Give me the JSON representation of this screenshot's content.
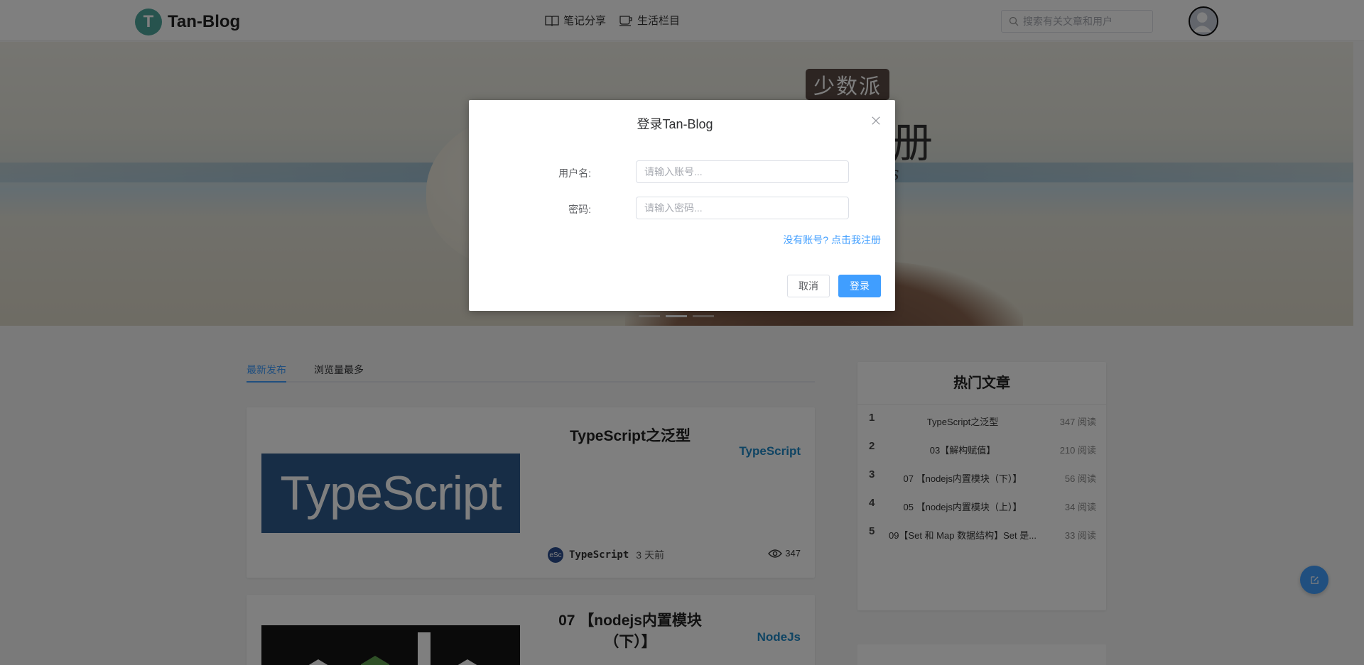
{
  "header": {
    "logo_letter": "T",
    "logo_text": "Tan-Blog",
    "nav": [
      {
        "label": "笔记分享",
        "icon": "book-icon"
      },
      {
        "label": "生活栏目",
        "icon": "coffee-cup-icon"
      }
    ],
    "search_placeholder": "搜索有关文章和用户"
  },
  "banner": {
    "badge": "少数派",
    "big_char": "册",
    "italic_text": "tors"
  },
  "tabs": [
    "最新发布",
    "浏览量最多"
  ],
  "articles": [
    {
      "title": "TypeScript之泛型",
      "tag": "TypeScript",
      "image_text": "TypeScript",
      "author_avatar": "eSc",
      "author": "TypeScript",
      "time": "3 天前",
      "views": "347"
    },
    {
      "title": "07 【nodejs内置模块（下）】",
      "tag": "NodeJs"
    }
  ],
  "hot": {
    "title": "热门文章",
    "items": [
      {
        "rank": "1",
        "name": "TypeScript之泛型",
        "reads": "347 阅读"
      },
      {
        "rank": "2",
        "name": "03【解构赋值】",
        "reads": "210 阅读"
      },
      {
        "rank": "3",
        "name": "07 【nodejs内置模块（下）】",
        "reads": "56 阅读"
      },
      {
        "rank": "4",
        "name": "05 【nodejs内置模块（上）】",
        "reads": "34 阅读"
      },
      {
        "rank": "5",
        "name": "09【Set 和 Map 数据结构】Set 是...",
        "reads": "33 阅读"
      }
    ]
  },
  "dialog": {
    "title": "登录Tan-Blog",
    "username_label": "用户名:",
    "username_placeholder": "请输入账号...",
    "password_label": "密码:",
    "password_placeholder": "请输入密码...",
    "register_link": "没有账号? 点击我注册",
    "cancel": "取消",
    "confirm": "登录"
  },
  "colors": {
    "accent": "#409eff",
    "logo": "#4fa79c",
    "tag": "#1e88c7"
  }
}
